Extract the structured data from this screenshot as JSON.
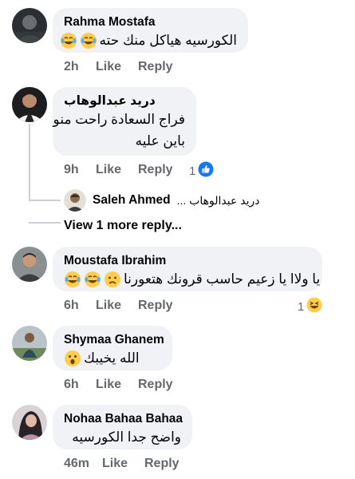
{
  "comments": [
    {
      "author": "Rahma Mostafa",
      "text": "الكورسيه هياكل منك حته",
      "emojis": [
        "laugh-cry",
        "laugh-cry"
      ],
      "time": "2h",
      "like": "Like",
      "reply": "Reply"
    },
    {
      "author": "دريد عبدالوهاب",
      "line1": "فراج السعادة راحت منو",
      "line2": "باين عليه",
      "time": "9h",
      "like": "Like",
      "reply": "Reply",
      "reaction_count": "1",
      "reaction": "like",
      "replies": {
        "preview_author": "Saleh Ahmed",
        "preview_text": "دريد عبدالوهاب ...",
        "view_more": "View 1 more reply..."
      }
    },
    {
      "author": "Moustafa Ibrahim",
      "text": "يا ولاا يا زعيم حاسب قرونك هتعورنا",
      "emojis": [
        "laugh-cry",
        "laugh-cry",
        "sad"
      ],
      "time": "6h",
      "like": "Like",
      "reply": "Reply",
      "reaction_count": "1",
      "reaction": "haha"
    },
    {
      "author": "Shymaa Ghanem",
      "text": "الله يخيبك",
      "emojis": [
        "wow"
      ],
      "time": "6h",
      "like": "Like",
      "reply": "Reply"
    },
    {
      "author": "Nohaa Bahaa Bahaa",
      "text": "واضح جدا الكورسيه",
      "time": "46m",
      "like": "Like",
      "reply": "Reply"
    }
  ],
  "colors": {
    "bubble": "#f0f2f5",
    "meta": "#65676b",
    "like_blue": "#1877f2",
    "emoji_yellow": "#ffcc4d"
  }
}
